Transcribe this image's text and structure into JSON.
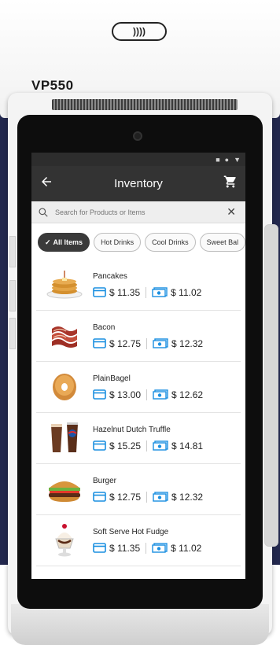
{
  "device": {
    "model": "VP550",
    "nfc_symbol": "))))"
  },
  "status_bar": {
    "icons": [
      "square-icon",
      "circle-icon",
      "triangle-icon"
    ]
  },
  "app_bar": {
    "title": "Inventory",
    "back_icon": "arrow-left-icon",
    "cart_icon": "cart-icon"
  },
  "search": {
    "placeholder": "Search for Products or Items",
    "value": ""
  },
  "chips": [
    {
      "label": "All Items",
      "active": true
    },
    {
      "label": "Hot Drinks",
      "active": false
    },
    {
      "label": "Cool Drinks",
      "active": false
    },
    {
      "label": "Sweet Bal",
      "active": false
    }
  ],
  "items": [
    {
      "name": "Pancakes",
      "card_price": "$ 11.35",
      "cash_price": "$ 11.02",
      "image": "pancakes"
    },
    {
      "name": "Bacon",
      "card_price": "$ 12.75",
      "cash_price": "$ 12.32",
      "image": "bacon"
    },
    {
      "name": "PlainBagel",
      "card_price": "$ 13.00",
      "cash_price": "$ 12.62",
      "image": "bagel"
    },
    {
      "name": "Hazelnut Dutch Truffle",
      "card_price": "$ 15.25",
      "cash_price": "$ 14.81",
      "image": "drinks"
    },
    {
      "name": "Burger",
      "card_price": "$ 12.75",
      "cash_price": "$ 12.32",
      "image": "burger"
    },
    {
      "name": "Soft Serve Hot Fudge",
      "card_price": "$ 11.35",
      "cash_price": "$ 11.02",
      "image": "sundae"
    }
  ],
  "colors": {
    "accent": "#1a8fe0",
    "app_bar": "#333333",
    "background_band": "#23284e"
  }
}
